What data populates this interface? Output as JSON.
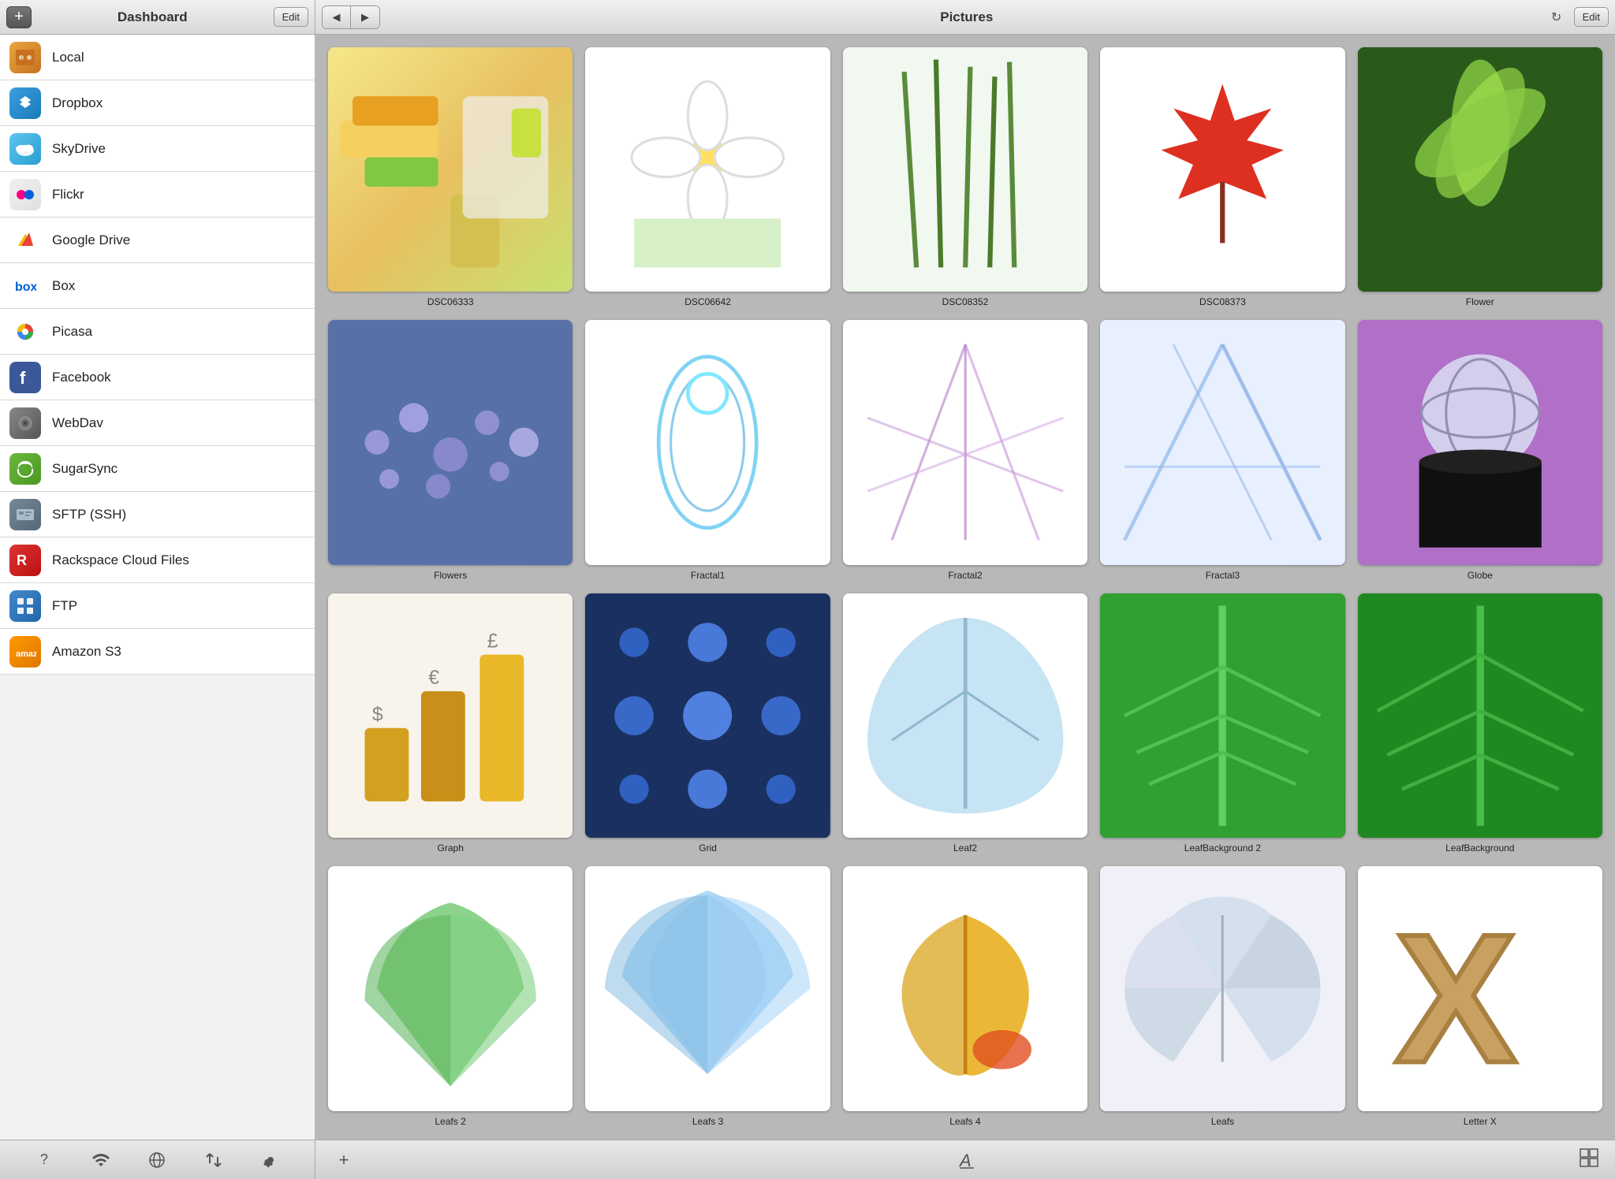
{
  "sidebar_header": {
    "add_label": "+",
    "title": "Dashboard",
    "edit_label": "Edit"
  },
  "main_header": {
    "back_label": "◀",
    "forward_label": "▶",
    "title": "Pictures",
    "edit_label": "Edit"
  },
  "sidebar_items": [
    {
      "id": "local",
      "label": "Local",
      "icon_class": "icon-local"
    },
    {
      "id": "dropbox",
      "label": "Dropbox",
      "icon_class": "icon-dropbox"
    },
    {
      "id": "skydrive",
      "label": "SkyDrive",
      "icon_class": "icon-skydrive"
    },
    {
      "id": "flickr",
      "label": "Flickr",
      "icon_class": "icon-flickr"
    },
    {
      "id": "googledrive",
      "label": "Google Drive",
      "icon_class": "icon-googledrive"
    },
    {
      "id": "box",
      "label": "Box",
      "icon_class": "icon-box"
    },
    {
      "id": "picasa",
      "label": "Picasa",
      "icon_class": "icon-picasa"
    },
    {
      "id": "facebook",
      "label": "Facebook",
      "icon_class": "icon-facebook"
    },
    {
      "id": "webdav",
      "label": "WebDav",
      "icon_class": "icon-webdav"
    },
    {
      "id": "sugarsync",
      "label": "SugarSync",
      "icon_class": "icon-sugarsync"
    },
    {
      "id": "sftp",
      "label": "SFTP (SSH)",
      "icon_class": "icon-sftp"
    },
    {
      "id": "rackspace",
      "label": "Rackspace Cloud Files",
      "icon_class": "icon-rackspace"
    },
    {
      "id": "ftp",
      "label": "FTP",
      "icon_class": "icon-ftp"
    },
    {
      "id": "amazon",
      "label": "Amazon S3",
      "icon_class": "icon-amazon"
    }
  ],
  "grid_items": [
    {
      "id": "dsc06333",
      "label": "DSC06333",
      "thumb_class": "thumb-soap",
      "color1": "#f5e88a",
      "color2": "#e8c060",
      "type": "soap"
    },
    {
      "id": "dsc06642",
      "label": "DSC06642",
      "thumb_class": "thumb-flower-white",
      "color1": "#f8f8f8",
      "color2": "#e8ffe8",
      "type": "white-flower"
    },
    {
      "id": "dsc08352",
      "label": "DSC08352",
      "thumb_class": "thumb-grass",
      "color1": "#e8f5e8",
      "color2": "#a8d8a8",
      "type": "grass"
    },
    {
      "id": "dsc08373",
      "label": "DSC08373",
      "thumb_class": "thumb-maple",
      "color1": "#f8f8f8",
      "color2": "#ffe8e8",
      "type": "maple"
    },
    {
      "id": "flower",
      "label": "Flower",
      "thumb_class": "thumb-flower-green",
      "color1": "#2a5a1a",
      "color2": "#4a8a2a",
      "type": "green-flower"
    },
    {
      "id": "flowers",
      "label": "Flowers",
      "thumb_class": "thumb-flowers-purple",
      "color1": "#5a7aaa",
      "color2": "#4a6a9a",
      "type": "purple-flowers"
    },
    {
      "id": "fractal1",
      "label": "Fractal1",
      "thumb_class": "thumb-fractal1",
      "color1": "#e8f8ff",
      "color2": "#c0e8f8",
      "type": "fractal1"
    },
    {
      "id": "fractal2",
      "label": "Fractal2",
      "thumb_class": "thumb-fractal2",
      "color1": "#f8f0f8",
      "color2": "#e8d8f0",
      "type": "fractal2"
    },
    {
      "id": "fractal3",
      "label": "Fractal3",
      "thumb_class": "thumb-fractal3",
      "color1": "#d8e8f8",
      "color2": "#b8d0f0",
      "type": "fractal3"
    },
    {
      "id": "globe",
      "label": "Globe",
      "thumb_class": "thumb-globe",
      "color1": "#b880d0",
      "color2": "#9060b0",
      "type": "globe"
    },
    {
      "id": "graph",
      "label": "Graph",
      "thumb_class": "thumb-graph",
      "color1": "#f8f0d8",
      "color2": "#e8e0c8",
      "type": "graph"
    },
    {
      "id": "grid",
      "label": "Grid",
      "thumb_class": "thumb-grid",
      "color1": "#1a3a6a",
      "color2": "#2a4a8a",
      "type": "grid"
    },
    {
      "id": "leaf2",
      "label": "Leaf2",
      "thumb_class": "thumb-leaf2",
      "color1": "#e8f4f8",
      "color2": "#c8e8f4",
      "type": "leaf2"
    },
    {
      "id": "leafbackground2",
      "label": "LeafBackground 2",
      "thumb_class": "thumb-leafbg2",
      "color1": "#30a030",
      "color2": "#208020",
      "type": "leafbg2"
    },
    {
      "id": "leafbackground",
      "label": "LeafBackground",
      "thumb_class": "thumb-leafbg",
      "color1": "#28a828",
      "color2": "#188818",
      "type": "leafbg"
    },
    {
      "id": "leafs2",
      "label": "Leafs 2",
      "thumb_class": "thumb-leafs2",
      "color1": "#f0fff0",
      "color2": "#c8f0c8",
      "type": "leafs2"
    },
    {
      "id": "leafs3",
      "label": "Leafs 3",
      "thumb_class": "thumb-leafs3",
      "color1": "#e8f4ff",
      "color2": "#c8e4f8",
      "type": "leafs3"
    },
    {
      "id": "leafs4",
      "label": "Leafs 4",
      "thumb_class": "thumb-leafs4",
      "color1": "#fff8e8",
      "color2": "#f8e8c0",
      "type": "leafs4"
    },
    {
      "id": "leafs",
      "label": "Leafs",
      "thumb_class": "thumb-leafs",
      "color1": "#f8f8ff",
      "color2": "#e8e8f8",
      "type": "leafs"
    },
    {
      "id": "letterx",
      "label": "Letter X",
      "thumb_class": "thumb-letterx",
      "color1": "#f8f0e8",
      "color2": "#e8d8c0",
      "type": "letterx"
    }
  ],
  "bottom_sidebar": {
    "help_label": "?",
    "wifi_label": "wifi",
    "globe_label": "globe",
    "transfer_label": "transfer",
    "settings_label": "gear"
  },
  "bottom_main": {
    "add_label": "+",
    "font_label": "A",
    "grid_label": "grid"
  }
}
